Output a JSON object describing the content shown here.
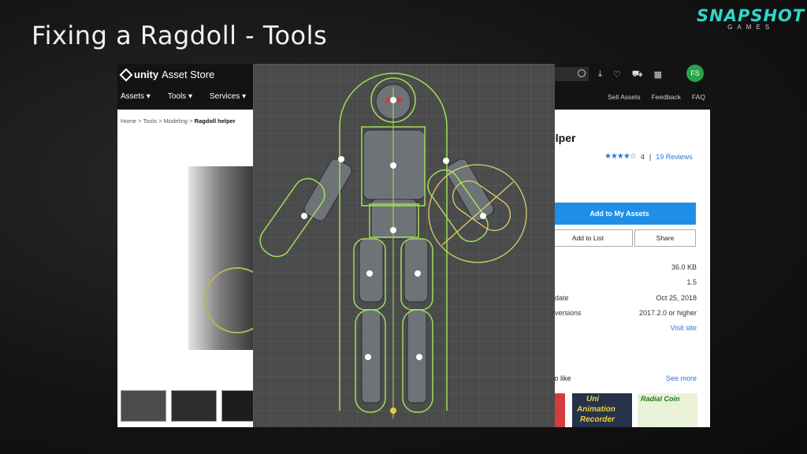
{
  "slide": {
    "title": "Fixing a Ragdoll - Tools",
    "brand_main": "SNAPSHOT",
    "brand_sub": "GAMES"
  },
  "store": {
    "logo_text_1": "unity",
    "logo_text_2": "Asset Store",
    "nav": [
      "Assets",
      "Tools",
      "Services"
    ],
    "avatar": "FS",
    "subnav": [
      "Sell Assets",
      "Feedback",
      "FAQ"
    ],
    "breadcrumb": [
      "Home",
      "Tools",
      "Modeling"
    ],
    "breadcrumb_current": "Ragdoll helper",
    "breadcrumb_sep": ">",
    "title_partial": "elper",
    "rating_value": "4",
    "rating_sep": "|",
    "reviews": "19 Reviews",
    "add_button": "Add to My Assets",
    "list_button": "Add to List",
    "share_button": "Share",
    "info": [
      {
        "label": "",
        "value": "36.0 KB"
      },
      {
        "label": "",
        "value": "1.5"
      },
      {
        "label": "date",
        "value": "Oct 25, 2018"
      },
      {
        "label": "versions",
        "value": "2017.2.0 or higher"
      },
      {
        "label": "",
        "value": "Visit site"
      }
    ],
    "also_like": "so like",
    "see_more": "See more",
    "rec1_title": [
      "Uni",
      "Animation",
      "Recorder"
    ],
    "rec2_title": "Radial Coin"
  },
  "colors": {
    "brand": "#2fd6c6",
    "accent_blue": "#1e8fe8",
    "collider_green": "#9fe05a",
    "avatar_green": "#2aa34a"
  }
}
